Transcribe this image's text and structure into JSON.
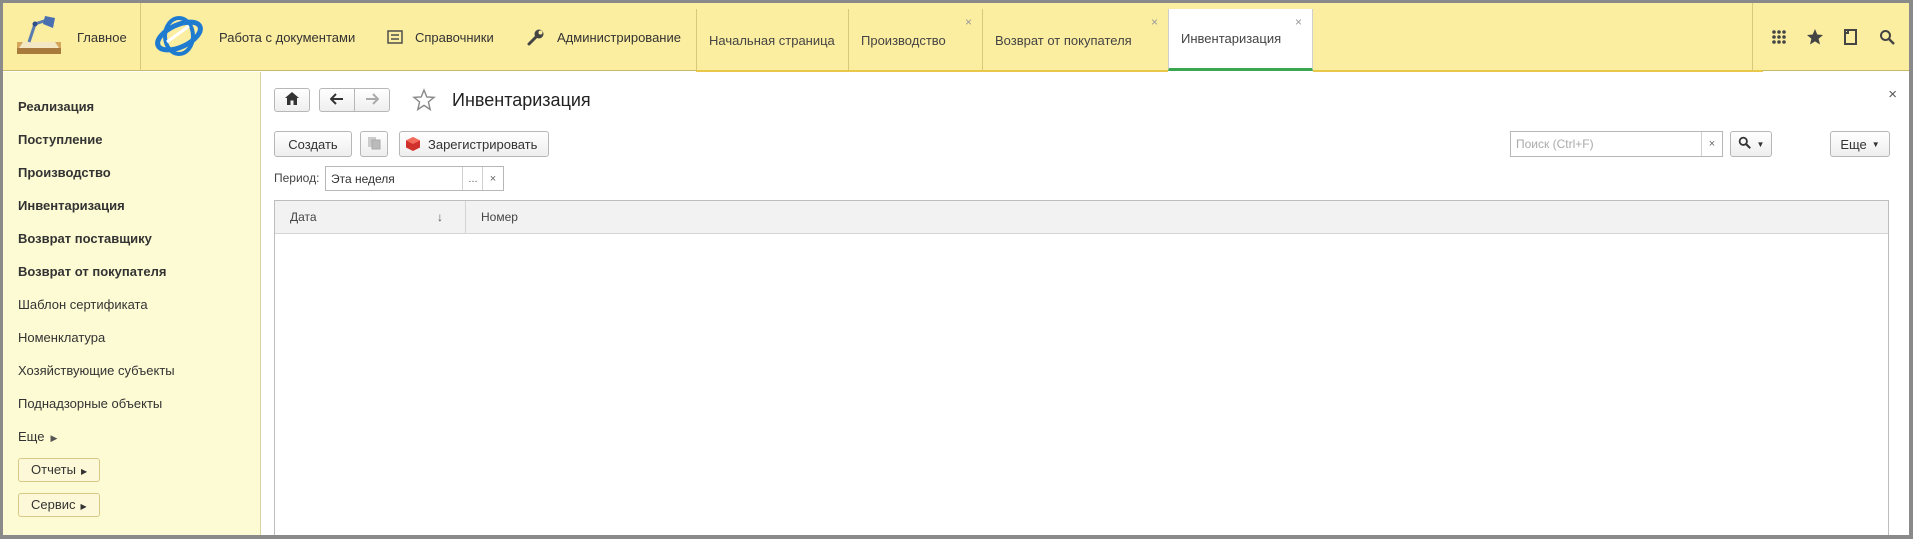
{
  "topbar": {
    "home_label": "Главное",
    "docs_label": "Работа с документами",
    "sprav_label": "Справочники",
    "admin_label": "Администрирование",
    "tabs": [
      {
        "label": "Начальная страница",
        "closable": false
      },
      {
        "label": "Производство",
        "closable": true
      },
      {
        "label": "Возврат от покупателя",
        "closable": true
      },
      {
        "label": "Инвентаризация",
        "closable": true,
        "active": true
      }
    ],
    "close_glyph": "×",
    "right_icons": [
      "apps-grid-icon",
      "star-icon",
      "history-icon",
      "search-icon"
    ]
  },
  "sidebar": {
    "items": [
      {
        "label": "Реализация",
        "bold": true
      },
      {
        "label": "Поступление",
        "bold": true
      },
      {
        "label": "Производство",
        "bold": true
      },
      {
        "label": "Инвентаризация",
        "bold": true
      },
      {
        "label": "Возврат поставщику",
        "bold": true
      },
      {
        "label": "Возврат от покупателя",
        "bold": true
      },
      {
        "label": "Шаблон сертификата",
        "bold": false
      },
      {
        "label": "Номенклатура",
        "bold": false
      },
      {
        "label": "Хозяйствующие субъекты",
        "bold": false
      },
      {
        "label": "Поднадзорные объекты",
        "bold": false
      }
    ],
    "more_label": "Еще",
    "reports_label": "Отчеты",
    "service_label": "Сервис"
  },
  "main": {
    "title": "Инвентаризация",
    "create_label": "Создать",
    "register_label": "Зарегистрировать",
    "search_placeholder": "Поиск (Ctrl+F)",
    "more_label": "Еще",
    "period_label": "Период:",
    "period_value": "Эта неделя",
    "period_dots": "...",
    "columns": [
      "Дата",
      "Номер"
    ],
    "sort_glyph": "↓",
    "close_glyph": "×"
  },
  "colors": {
    "topbar_bg": "#fbeea0",
    "sidebar_bg": "#fdfbd3",
    "active_tab_underline": "#3aa650"
  }
}
